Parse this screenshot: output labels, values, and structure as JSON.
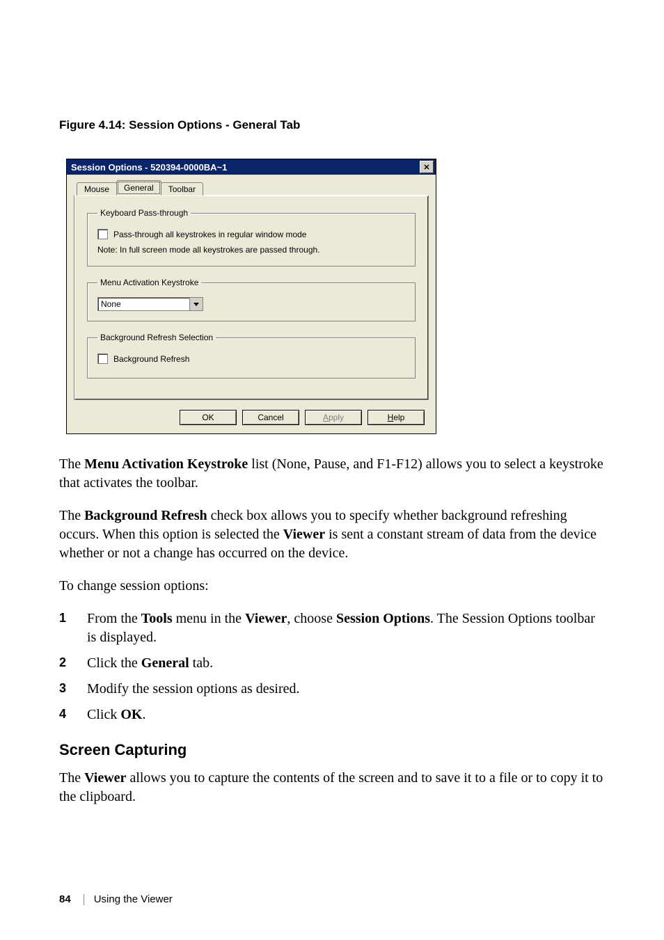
{
  "figure_caption": "Figure 4.14: Session Options - General Tab",
  "dialog": {
    "title": "Session Options - 520394-0000BA~1",
    "close_glyph": "✕",
    "tabs": {
      "mouse": "Mouse",
      "general": "General",
      "toolbar": "Toolbar"
    },
    "groups": {
      "passthrough": {
        "legend": "Keyboard Pass-through",
        "checkbox_label": "Pass-through all keystrokes in regular window mode",
        "note": "Note: In full screen mode all keystrokes are passed through."
      },
      "menu_key": {
        "legend": "Menu Activation Keystroke",
        "selected": "None"
      },
      "bg_refresh": {
        "legend": "Background Refresh Selection",
        "checkbox_label": "Background Refresh"
      }
    },
    "buttons": {
      "ok": "OK",
      "cancel": "Cancel",
      "apply_prefix": "A",
      "apply_rest": "pply",
      "help_prefix": "H",
      "help_rest": "elp"
    }
  },
  "body": {
    "para1_pre": "The ",
    "para1_b1": "Menu Activation Keystroke",
    "para1_post": " list (None, Pause, and F1-F12) allows you to select a keystroke that activates the toolbar.",
    "para2_pre": "The ",
    "para2_b1": "Background Refresh",
    "para2_mid": " check box allows you to specify whether background refreshing occurs. When this option is selected the ",
    "para2_b2": "Viewer",
    "para2_post": " is sent a constant stream of data from the device whether or not a change has occurred on the device.",
    "para3": "To change session options:",
    "steps": [
      {
        "num": "1",
        "parts": [
          "From the ",
          "Tools",
          " menu in the ",
          "Viewer",
          ", choose ",
          "Session Options",
          ". The Session Options toolbar is displayed."
        ]
      },
      {
        "num": "2",
        "parts": [
          "Click the ",
          "General",
          " tab."
        ]
      },
      {
        "num": "3",
        "plain": "Modify the session options as desired."
      },
      {
        "num": "4",
        "parts": [
          "Click ",
          "OK",
          "."
        ]
      }
    ],
    "section_head": "Screen Capturing",
    "para4_pre": "The ",
    "para4_b1": "Viewer",
    "para4_post": " allows you to capture the contents of the screen and to save it to a file or to copy it to the clipboard."
  },
  "footer": {
    "page_number": "84",
    "chapter": "Using the Viewer"
  }
}
